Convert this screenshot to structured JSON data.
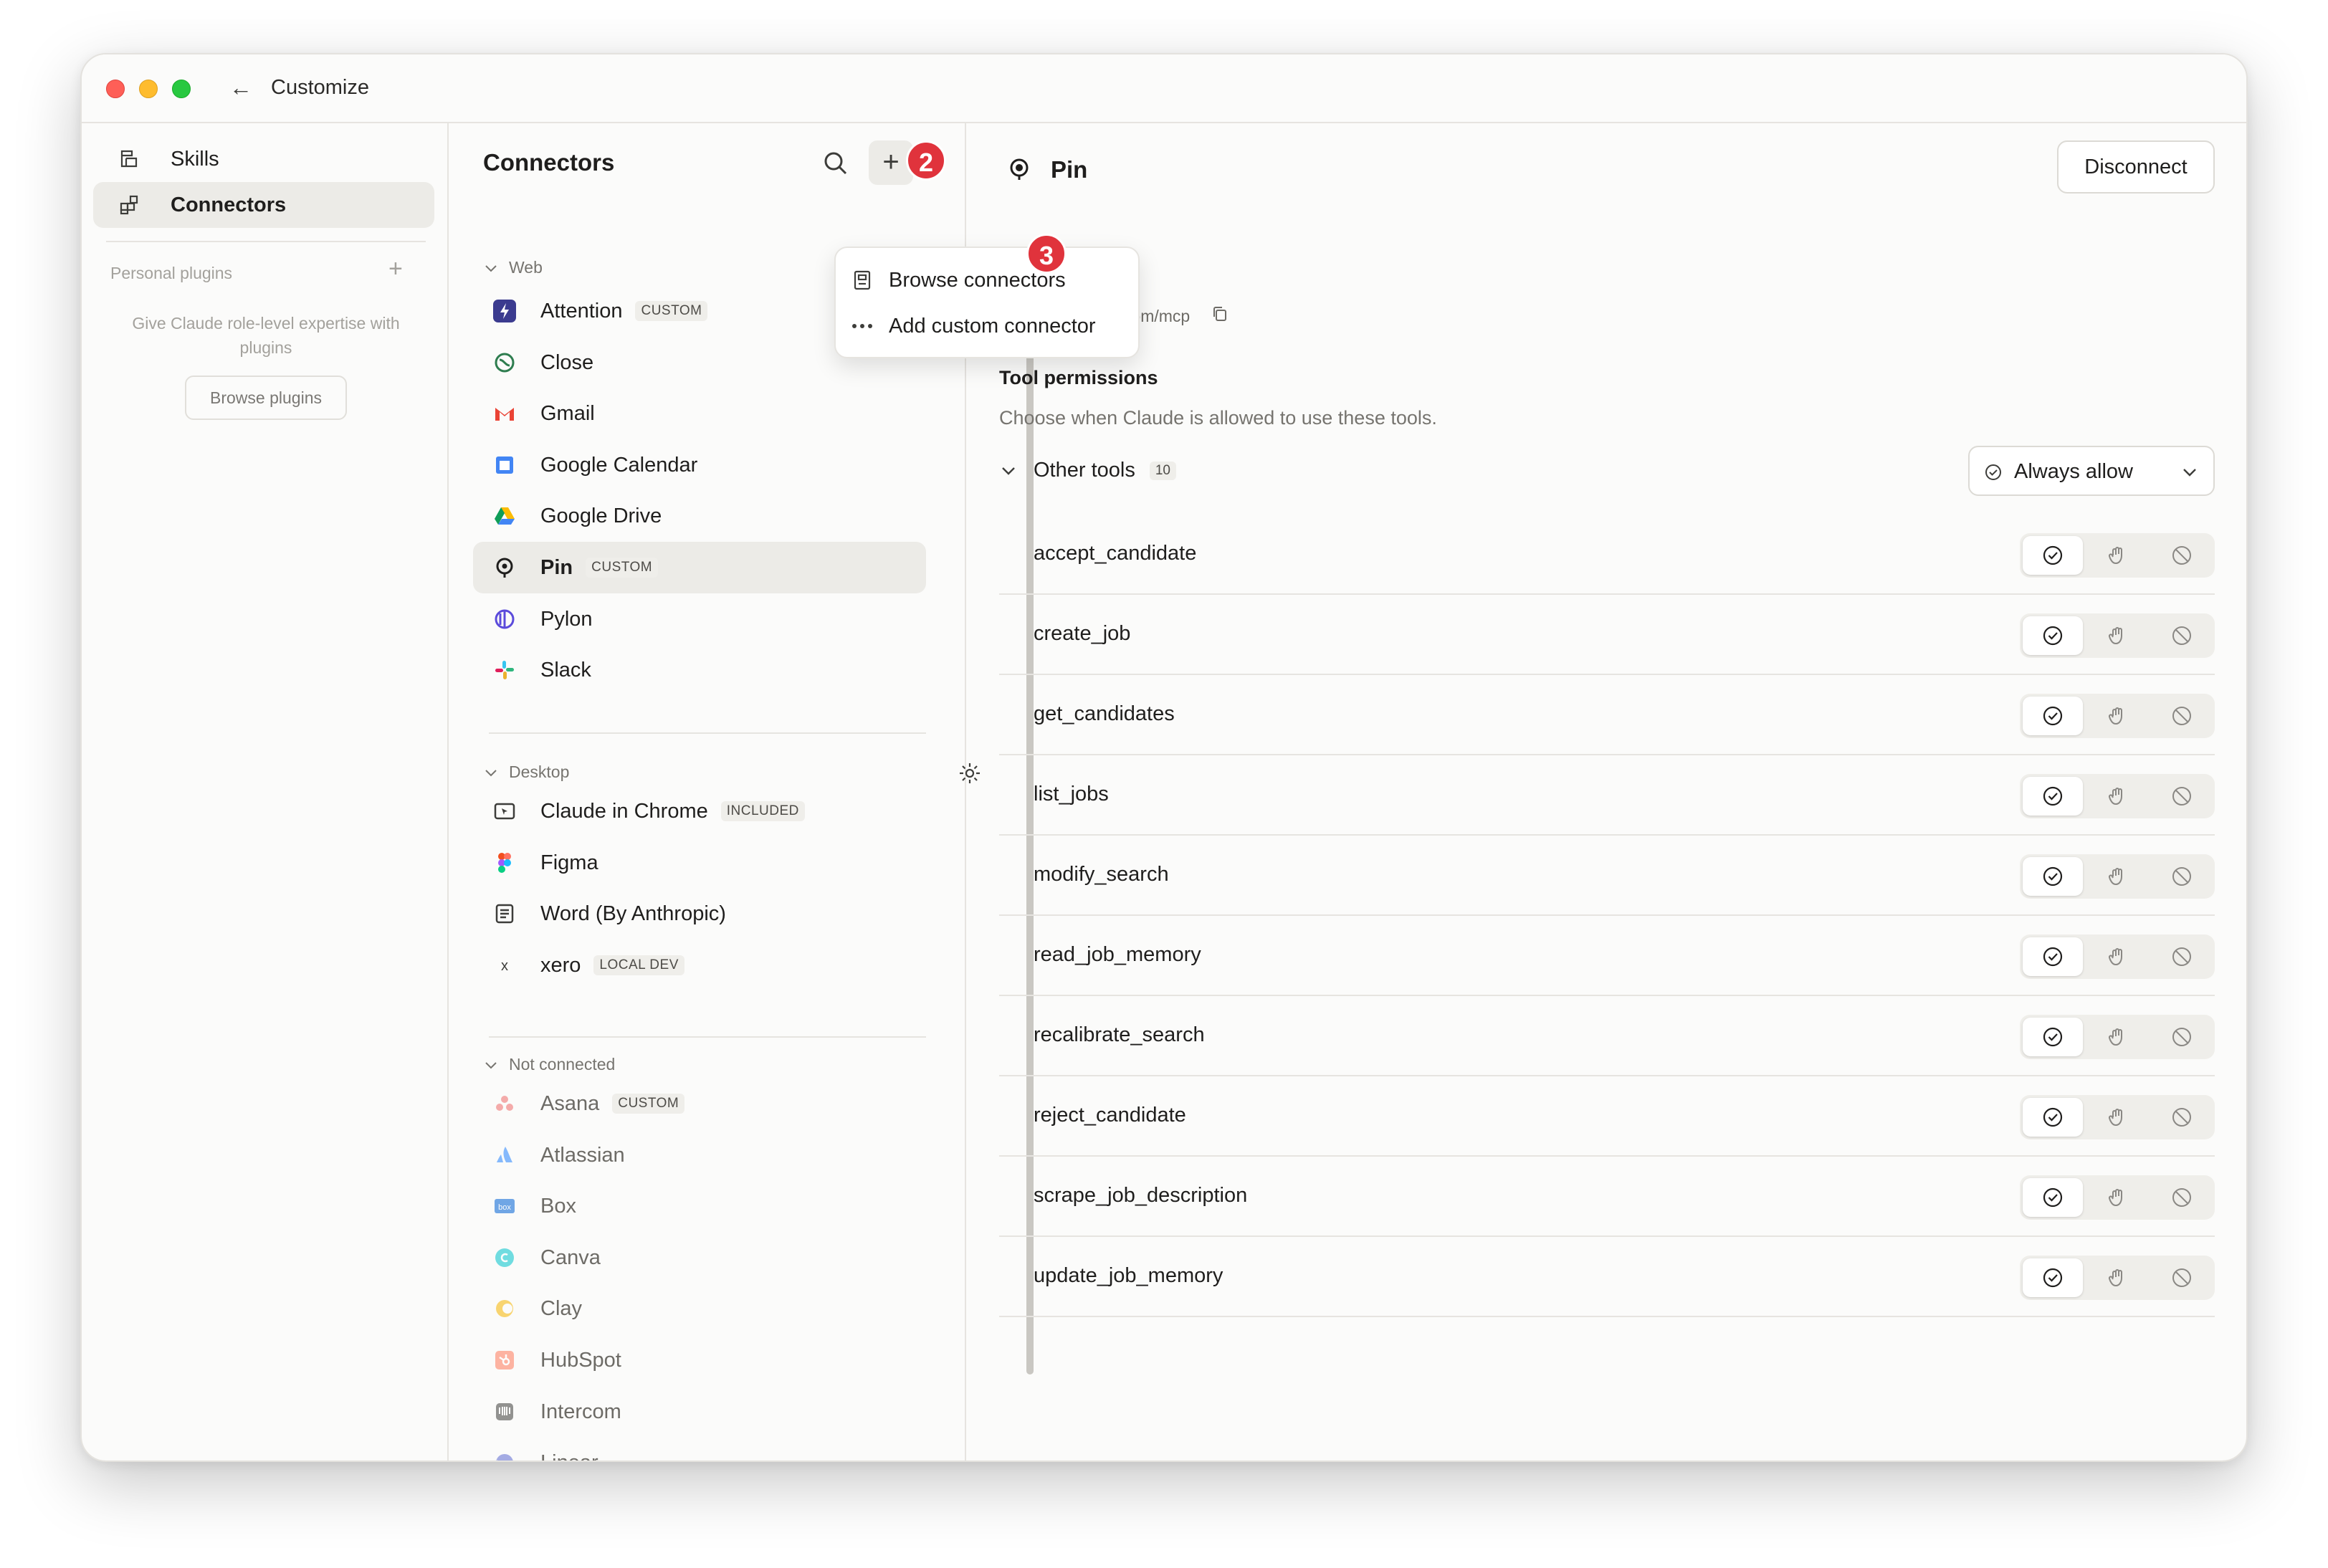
{
  "window": {
    "title": "Customize",
    "back_icon": "arrow-left-icon"
  },
  "sidebar": {
    "items": [
      {
        "label": "Skills",
        "icon": "skills-icon",
        "active": false
      },
      {
        "label": "Connectors",
        "icon": "connectors-icon",
        "active": true
      }
    ],
    "personal_plugins_label": "Personal plugins",
    "plugin_hint": "Give Claude role-level expertise with plugins",
    "browse_plugins_label": "Browse plugins"
  },
  "connectors": {
    "title": "Connectors",
    "add_badge": "2",
    "sections": {
      "web": "Web",
      "desktop": "Desktop",
      "not_connected": "Not connected"
    },
    "web": [
      {
        "name": "Attention",
        "tag": "CUSTOM",
        "icon": "attention-icon",
        "color": "#3b3b8f"
      },
      {
        "name": "Close",
        "tag": "",
        "icon": "close-crm-icon",
        "color": "#2e7d4f"
      },
      {
        "name": "Gmail",
        "tag": "",
        "icon": "gmail-icon",
        "color": "#ea4335"
      },
      {
        "name": "Google Calendar",
        "tag": "",
        "icon": "google-calendar-icon",
        "color": "#4285f4"
      },
      {
        "name": "Google Drive",
        "tag": "",
        "icon": "google-drive-icon",
        "color": "#0f9d58"
      },
      {
        "name": "Pin",
        "tag": "CUSTOM",
        "icon": "pin-icon",
        "color": "#1f1e1d",
        "selected": true
      },
      {
        "name": "Pylon",
        "tag": "",
        "icon": "pylon-icon",
        "color": "#5b4bdb"
      },
      {
        "name": "Slack",
        "tag": "",
        "icon": "slack-icon",
        "color": "#e01e5a"
      }
    ],
    "desktop": [
      {
        "name": "Claude in Chrome",
        "tag": "INCLUDED",
        "icon": "chrome-window-icon",
        "color": "#3d3d3a"
      },
      {
        "name": "Figma",
        "tag": "",
        "icon": "figma-icon",
        "color": "#f24e1e"
      },
      {
        "name": "Word (By Anthropic)",
        "tag": "",
        "icon": "word-icon",
        "color": "#3d3d3a"
      },
      {
        "name": "xero",
        "tag": "LOCAL DEV",
        "icon": "x-letter-icon",
        "color": "#3d3d3a"
      }
    ],
    "not_connected": [
      {
        "name": "Asana",
        "tag": "CUSTOM",
        "icon": "asana-icon",
        "color": "#f06a6a"
      },
      {
        "name": "Atlassian",
        "tag": "",
        "icon": "atlassian-icon",
        "color": "#2684ff"
      },
      {
        "name": "Box",
        "tag": "",
        "icon": "box-icon",
        "color": "#0061d5"
      },
      {
        "name": "Canva",
        "tag": "",
        "icon": "canva-icon",
        "color": "#00c4cc"
      },
      {
        "name": "Clay",
        "tag": "",
        "icon": "clay-icon",
        "color": "#f7b500"
      },
      {
        "name": "HubSpot",
        "tag": "",
        "icon": "hubspot-icon",
        "color": "#ff7a59"
      },
      {
        "name": "Intercom",
        "tag": "",
        "icon": "intercom-icon",
        "color": "#3d3d3a"
      },
      {
        "name": "Linear",
        "tag": "",
        "icon": "linear-icon",
        "color": "#5e6ad2"
      }
    ]
  },
  "menu": {
    "items": [
      {
        "label": "Browse connectors",
        "icon": "book-icon"
      },
      {
        "label": "Add custom connector",
        "icon": "more-dots-icon"
      }
    ],
    "badge": "3"
  },
  "detail": {
    "title": "Pin",
    "disconnect_label": "Disconnect",
    "url": "mcp.pin.com/mcp",
    "permissions_title": "Tool permissions",
    "permissions_desc": "Choose when Claude is allowed to use these tools.",
    "group_label": "Other tools",
    "group_count": "10",
    "policy_label": "Always allow",
    "tools": [
      {
        "name": "accept_candidate",
        "mode": "allow"
      },
      {
        "name": "create_job",
        "mode": "allow"
      },
      {
        "name": "get_candidates",
        "mode": "allow"
      },
      {
        "name": "list_jobs",
        "mode": "allow"
      },
      {
        "name": "modify_search",
        "mode": "allow"
      },
      {
        "name": "read_job_memory",
        "mode": "allow"
      },
      {
        "name": "recalibrate_search",
        "mode": "allow"
      },
      {
        "name": "reject_candidate",
        "mode": "allow"
      },
      {
        "name": "scrape_job_description",
        "mode": "allow"
      },
      {
        "name": "update_job_memory",
        "mode": "allow"
      }
    ]
  },
  "colors": {
    "accent_badge": "#e0333c",
    "selected_row": "#ecebe7",
    "border": "#e6e4e0"
  }
}
